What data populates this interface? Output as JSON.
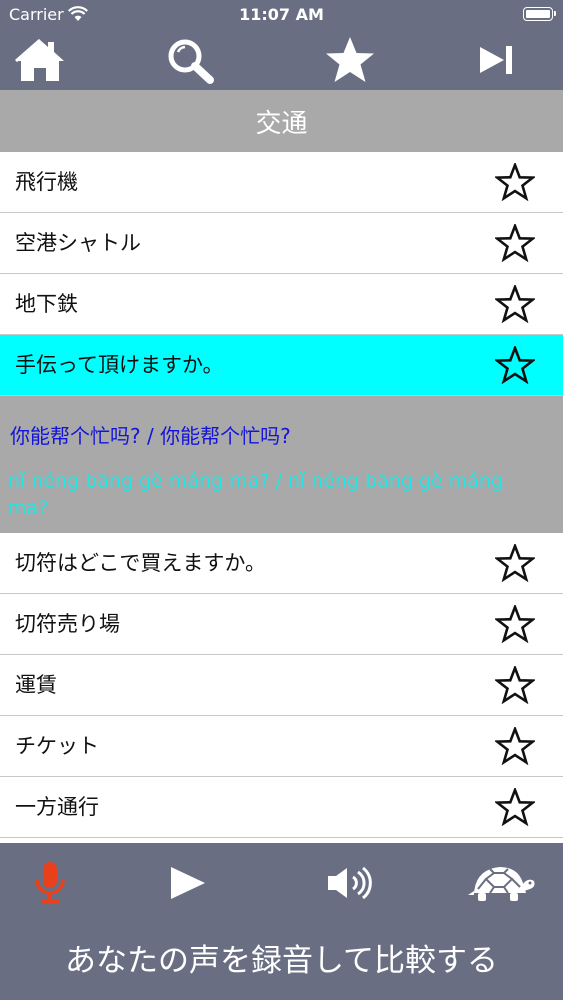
{
  "status_bar": {
    "carrier": "Carrier",
    "time": "11:07 AM"
  },
  "toolbar": {
    "home_icon": "home-icon",
    "search_icon": "search-icon",
    "favorites_icon": "star-icon",
    "next_icon": "skip-next-icon"
  },
  "section": {
    "title": "交通"
  },
  "list": {
    "items": [
      {
        "label": "飛行機"
      },
      {
        "label": "空港シャトル"
      },
      {
        "label": "地下鉄"
      },
      {
        "label": "手伝って頂けますか。",
        "selected": true
      },
      {
        "label": "切符はどこで買えますか。"
      },
      {
        "label": "切符売り場"
      },
      {
        "label": "運賃"
      },
      {
        "label": "チケット"
      },
      {
        "label": "一方通行"
      }
    ],
    "expanded": {
      "chinese": "你能帮个忙吗? / 你能帮个忙吗?",
      "pinyin": "nǐ néng bāng gè máng ma? / nǐ néng bāng gè máng ma?"
    }
  },
  "bottom": {
    "mic_icon": "microphone-icon",
    "play_icon": "play-icon",
    "speaker_icon": "speaker-icon",
    "slow_icon": "turtle-icon",
    "record_prompt": "あなたの声を録音して比較する"
  },
  "colors": {
    "bar": "#6a6e82",
    "section": "#a9a9a9",
    "selected": "#00ffff",
    "chinese_text": "#1414d8",
    "pinyin_text": "#22e6e6",
    "mic_active": "#e8401a"
  }
}
